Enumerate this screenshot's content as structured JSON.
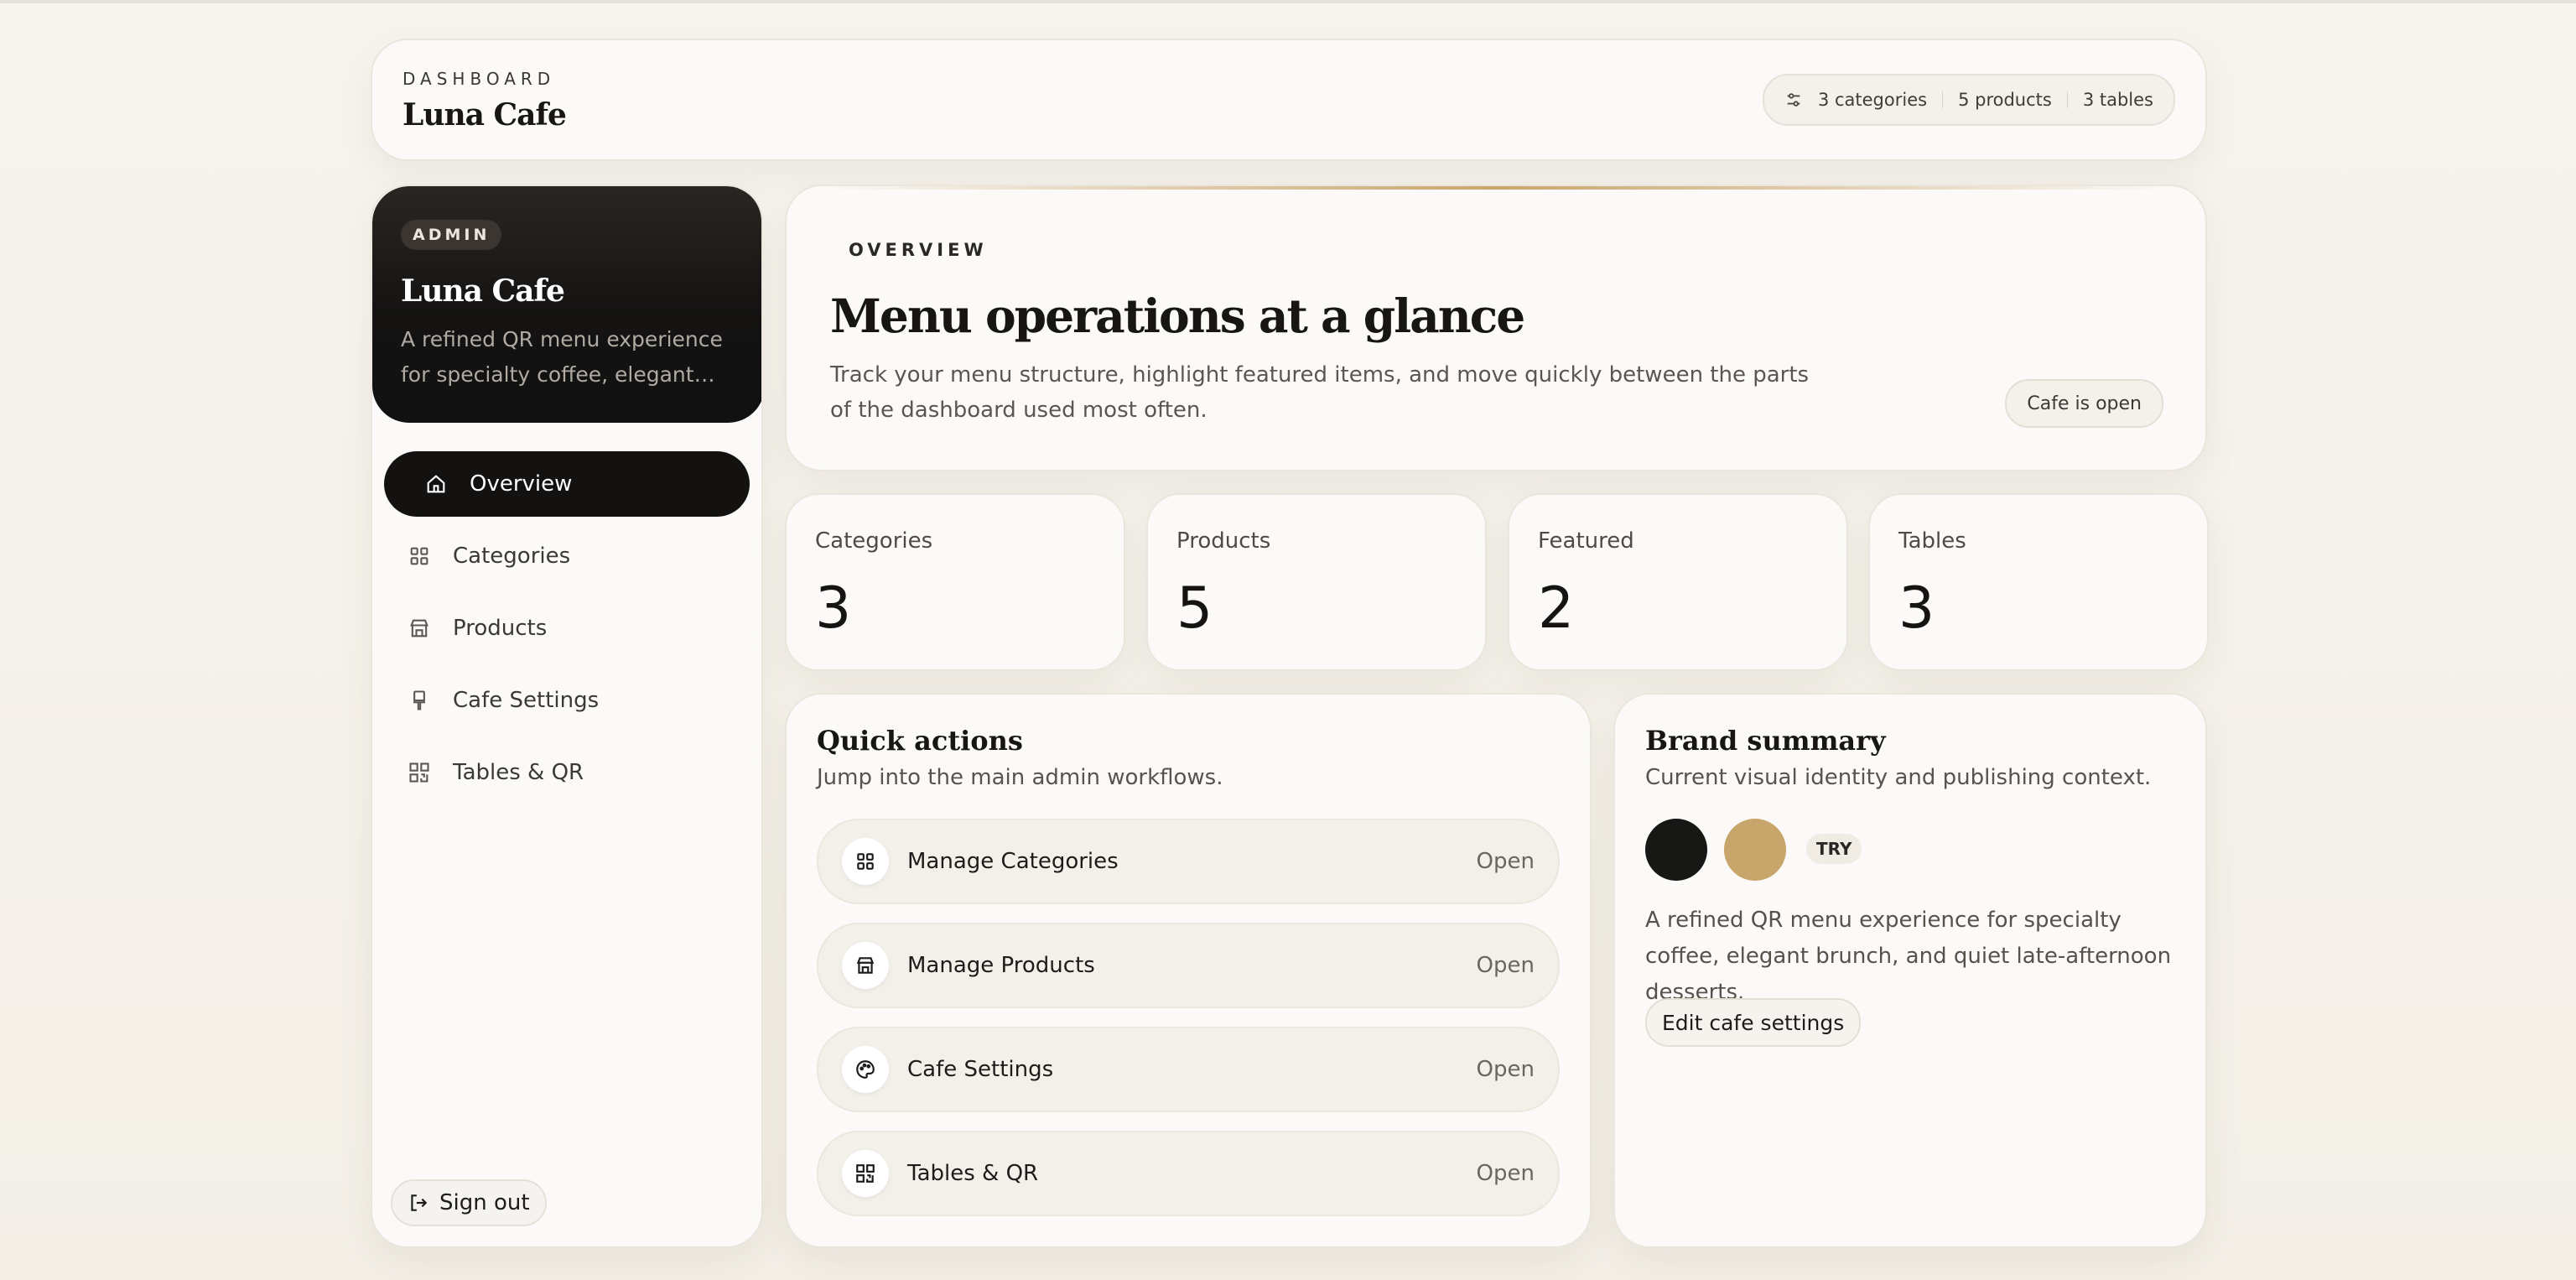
{
  "header": {
    "label": "DASHBOARD",
    "cafe_name": "Luna Cafe",
    "stats": {
      "categories": "3 categories",
      "products": "5 products",
      "tables": "3 tables"
    }
  },
  "sidebar": {
    "badge": "ADMIN",
    "cafe_name": "Luna Cafe",
    "description": "A refined QR menu experience for specialty coffee, elegant brunch, and quiet late-afternoon desserts.",
    "items": [
      {
        "label": "Overview",
        "icon": "home-icon",
        "active": true
      },
      {
        "label": "Categories",
        "icon": "grid-icon"
      },
      {
        "label": "Products",
        "icon": "store-icon"
      },
      {
        "label": "Cafe Settings",
        "icon": "brush-icon"
      },
      {
        "label": "Tables & QR",
        "icon": "qr-icon"
      }
    ],
    "signout": "Sign out"
  },
  "overview": {
    "label": "OVERVIEW",
    "title": "Menu operations at a glance",
    "description": "Track your menu structure, highlight featured items, and move quickly between the parts of the dashboard used most often.",
    "status": "Cafe is open"
  },
  "stats": [
    {
      "label": "Categories",
      "value": "3"
    },
    {
      "label": "Products",
      "value": "5"
    },
    {
      "label": "Featured",
      "value": "2"
    },
    {
      "label": "Tables",
      "value": "3"
    }
  ],
  "quick_actions": {
    "title": "Quick actions",
    "subtitle": "Jump into the main admin workflows.",
    "items": [
      {
        "label": "Manage Categories",
        "action": "Open",
        "icon": "grid-icon"
      },
      {
        "label": "Manage Products",
        "action": "Open",
        "icon": "store-icon"
      },
      {
        "label": "Cafe Settings",
        "action": "Open",
        "icon": "palette-icon"
      },
      {
        "label": "Tables & QR",
        "action": "Open",
        "icon": "qr-icon"
      }
    ]
  },
  "brand_summary": {
    "title": "Brand summary",
    "subtitle": "Current visual identity and publishing context.",
    "primary_color": "#171716",
    "accent_color": "#c8a56b",
    "currency": "TRY",
    "description": "A refined QR menu experience for specialty coffee, elegant brunch, and quiet late-afternoon desserts.",
    "edit_button": "Edit cafe settings"
  }
}
